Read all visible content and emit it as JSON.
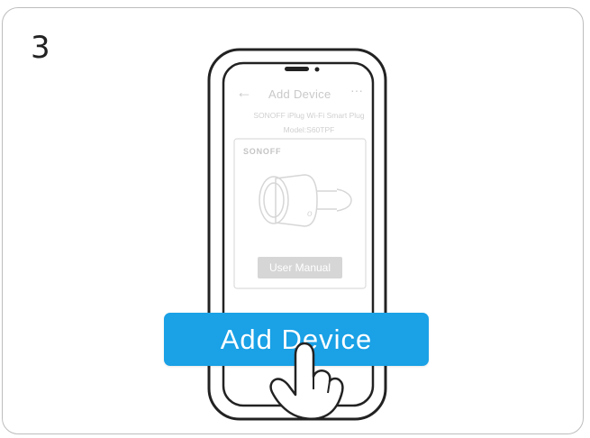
{
  "step_number": "3",
  "app": {
    "title": "Add Device",
    "back_icon": "←",
    "more_icon": "···",
    "product_name": "SONOFF iPlug Wi-Fi Smart Plug",
    "model": "Model:S60TPF",
    "brand": "SONOFF",
    "manual_button": "User Manual"
  },
  "cta": {
    "label": "Add Device",
    "color": "#1aa1e6"
  },
  "icons": [
    "back-arrow-icon",
    "more-dots-icon",
    "smart-plug-icon",
    "pointing-hand-icon"
  ]
}
